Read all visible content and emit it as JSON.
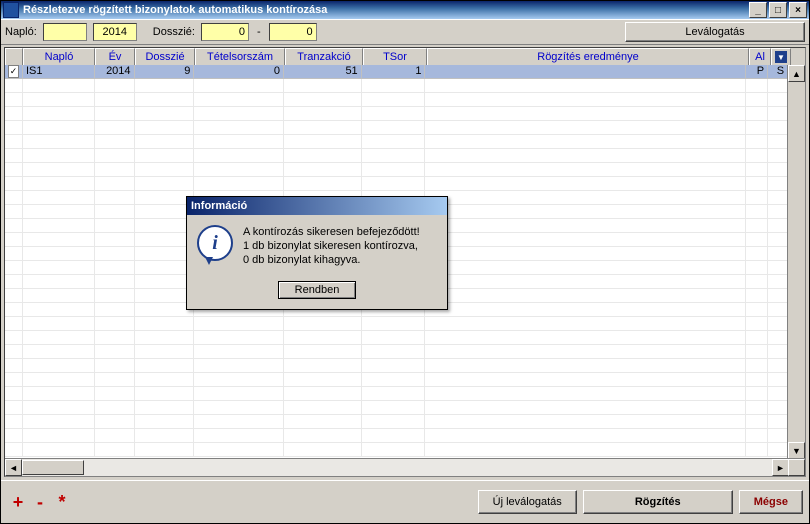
{
  "window": {
    "title": "Részletezve rögzített bizonylatok automatikus kontírozása"
  },
  "params": {
    "naplo_label": "Napló:",
    "naplo_value": "",
    "ev_value": "2014",
    "dosszier_label": "Dosszié:",
    "dosszier_from": "0",
    "dosszier_to": "0",
    "levalogatas_btn": "Leválogatás"
  },
  "grid": {
    "headers": [
      "",
      "Napló",
      "Év",
      "Dosszié",
      "Tételsorszám",
      "Tranzakció",
      "TSor",
      "Rögzítés eredménye",
      "Al",
      ""
    ],
    "row": {
      "checked": "✓",
      "naplo": "IS1",
      "ev": "2014",
      "dosszier": "9",
      "tetel": "0",
      "tranz": "51",
      "tsor": "1",
      "eredmeny": "",
      "al": "P",
      "last": "S"
    }
  },
  "dialog": {
    "title": "Információ",
    "line1": "A kontírozás sikeresen befejeződött!",
    "line2": "1 db bizonylat sikeresen kontírozva,",
    "line3": "0 db bizonylat kihagyva.",
    "ok": "Rendben"
  },
  "footer": {
    "plus": "+",
    "minus": "-",
    "star": "*",
    "uj": "Új leválogatás",
    "rogzites": "Rögzítés",
    "megse": "Mégse"
  }
}
